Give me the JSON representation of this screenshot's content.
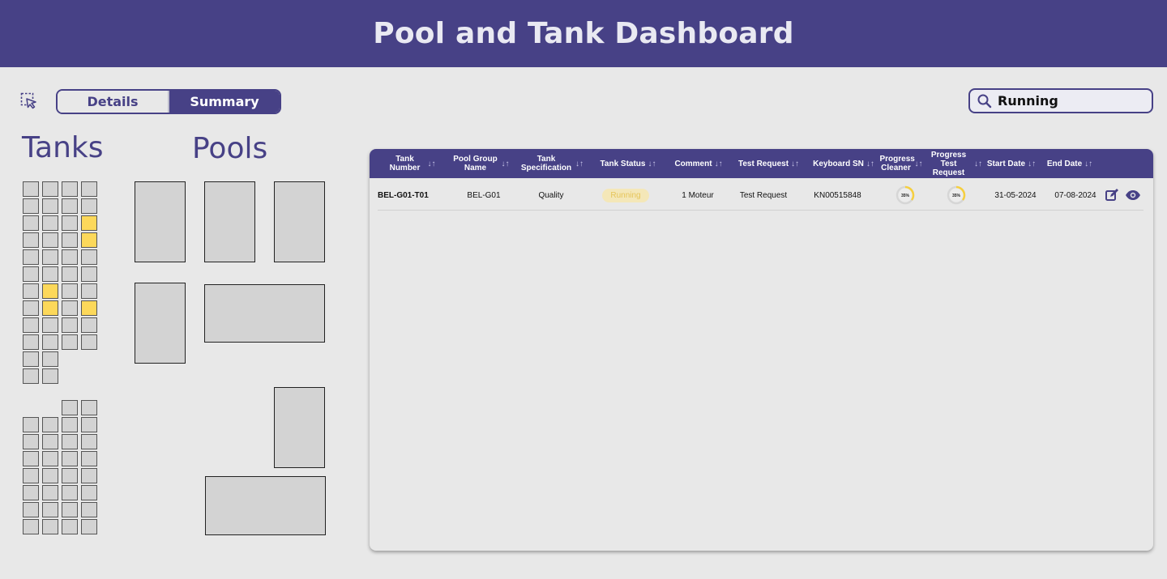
{
  "header": {
    "title": "Pool and Tank Dashboard"
  },
  "toolbar": {
    "select_icon": "dashed-select-cursor-icon",
    "tabs": [
      {
        "label": "Details",
        "active": false
      },
      {
        "label": "Summary",
        "active": true
      }
    ]
  },
  "search": {
    "value": "Running",
    "icon": "search-icon"
  },
  "tanks_section": {
    "title": "Tanks"
  },
  "pools_section": {
    "title": "Pools"
  },
  "colors": {
    "brand": "#474186",
    "tank_idle": "#d3d3d3",
    "tank_active": "#fcd85a",
    "status_running_bg": "#f4e7b8",
    "status_running_text": "#e6c55a",
    "progress_ring": "#f6cf3e"
  },
  "table": {
    "columns": [
      {
        "label": "Tank Number",
        "sortable": true
      },
      {
        "label": "Pool Group Name",
        "sortable": true
      },
      {
        "label": "Tank Specification",
        "sortable": true
      },
      {
        "label": "Tank Status",
        "sortable": true
      },
      {
        "label": "Comment",
        "sortable": true
      },
      {
        "label": "Test Request",
        "sortable": true
      },
      {
        "label": "Keyboard SN",
        "sortable": true
      },
      {
        "label": "Progress Cleaner",
        "sortable": true
      },
      {
        "label": "Progress Test Request",
        "sortable": true
      },
      {
        "label": "Start Date",
        "sortable": true
      },
      {
        "label": "End Date",
        "sortable": true
      }
    ],
    "rows": [
      {
        "tank_number": "BEL-G01-T01",
        "pool_group": "BEL-G01",
        "specification": "Quality",
        "status": "Running",
        "comment": "1 Moteur",
        "test_request": "Test Request",
        "keyboard_sn": "KN00515848",
        "progress_cleaner": "35%",
        "progress_test_request": "35%",
        "start_date": "31-05-2024",
        "end_date": "07-08-2024",
        "actions": [
          "edit-icon",
          "view-icon"
        ]
      }
    ]
  }
}
